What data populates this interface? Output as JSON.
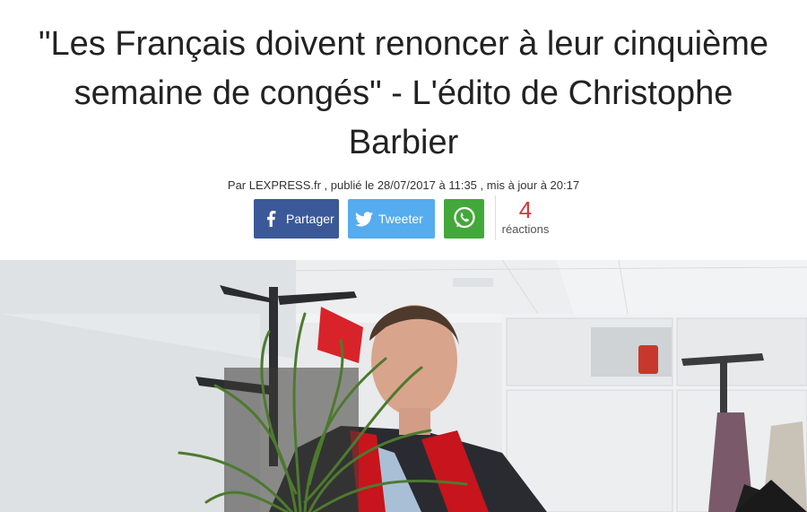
{
  "article": {
    "title": "\"Les Français doivent renoncer à leur cinquième semaine de congés\" - L'édito de Christophe Barbier",
    "byline": "Par LEXPRESS.fr , publié le 28/07/2017 à 11:35 , mis à jour à 20:17"
  },
  "share": {
    "facebook_label": "Partager",
    "twitter_label": "Tweeter",
    "facebook_icon": "facebook-icon",
    "twitter_icon": "twitter-icon",
    "whatsapp_icon": "whatsapp-icon"
  },
  "reactions": {
    "count": "4",
    "label": "réactions"
  },
  "colors": {
    "facebook": "#3b5998",
    "twitter": "#55acee",
    "whatsapp": "#43a83a",
    "reactions_count": "#d9343b",
    "wall_sign": "#d8232a"
  }
}
